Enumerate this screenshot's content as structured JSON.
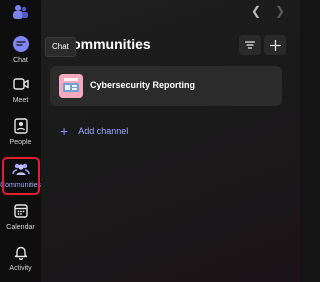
{
  "rail": {
    "items": [
      {
        "id": "chat",
        "label": "Chat",
        "icon": "chat-icon"
      },
      {
        "id": "meet",
        "label": "Meet",
        "icon": "video-camera-icon"
      },
      {
        "id": "people",
        "label": "People",
        "icon": "person-card-icon"
      },
      {
        "id": "communities",
        "label": "Communities",
        "icon": "communities-icon",
        "selected": true
      },
      {
        "id": "calendar",
        "label": "Calendar",
        "icon": "calendar-icon"
      },
      {
        "id": "activity",
        "label": "Activity",
        "icon": "bell-icon"
      }
    ]
  },
  "tooltip": {
    "text": "Chat"
  },
  "header": {
    "title": "Communities"
  },
  "community": {
    "name": "Cybersecurity Reporting"
  },
  "add_channel": {
    "label": "Add channel"
  },
  "colors": {
    "accent": "#8e92ff",
    "highlight_border": "#e0202e",
    "avatar_bg": "#f4a9bd"
  }
}
